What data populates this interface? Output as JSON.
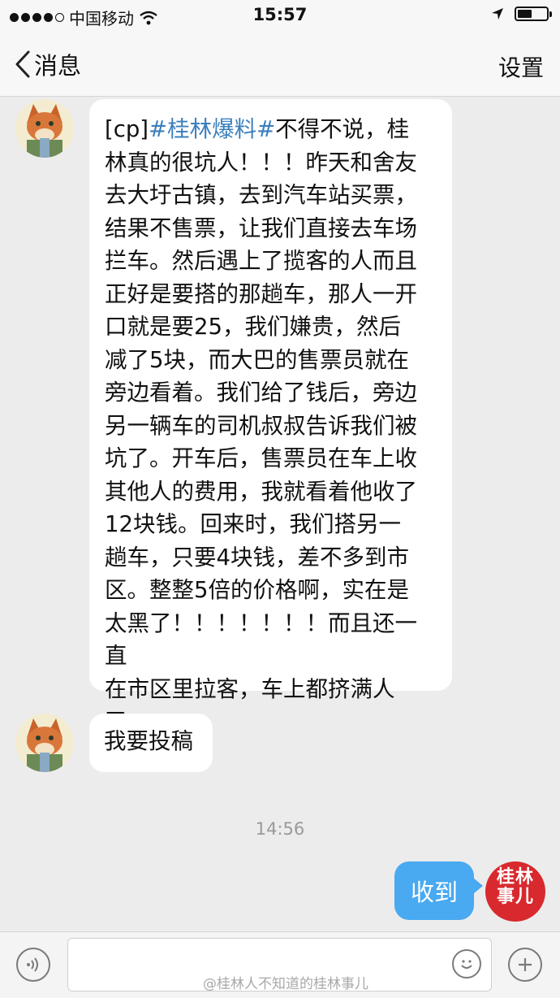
{
  "status_bar": {
    "carrier": "中国移动",
    "time": "15:57",
    "battery_level": 0.5
  },
  "nav": {
    "back_label": "消息",
    "settings_label": "设置"
  },
  "messages": {
    "first": {
      "prefix": "[cp]",
      "tag": "#桂林爆料#",
      "lines": [
        "不得不说，桂",
        "林真的很坑人！！！昨天和舍友",
        "去大圩古镇，去到汽车站买票，",
        "结果不售票，让我们直接去车场",
        "拦车。然后遇上了揽客的人而且",
        "正好是要搭的那趟车，那人一开",
        "口就是要25，我们嫌贵，然后",
        "减了5块，而大巴的售票员就在",
        "旁边看着。我们给了钱后，旁边",
        "另一辆车的司机叔叔告诉我们被",
        "坑了。开车后，售票员在车上收",
        "其他人的费用，我就看着他收了",
        "12块钱。回来时，我们搭另一",
        "趟车，只要4块钱，差不多到市",
        "区。整整5倍的价格啊，实在是",
        "太黑了！！！！！！！而且还一直",
        "在市区里拉客，车上都挤满人",
        "了。"
      ]
    },
    "second": "我要投稿",
    "timestamp": "14:56",
    "sent": "收到"
  },
  "brand_avatar": {
    "line1": "桂林",
    "line2": "事儿"
  },
  "input_bar": {
    "watermark": "@桂林人不知道的桂林事儿"
  },
  "icons": {
    "back": "chevron-left-icon",
    "voice": "voice-icon",
    "emoji": "emoji-icon",
    "plus": "plus-icon"
  },
  "colors": {
    "sent_bubble": "#49a9f1",
    "tag_link": "#3b7fbd",
    "brand_red": "#d8292e"
  }
}
